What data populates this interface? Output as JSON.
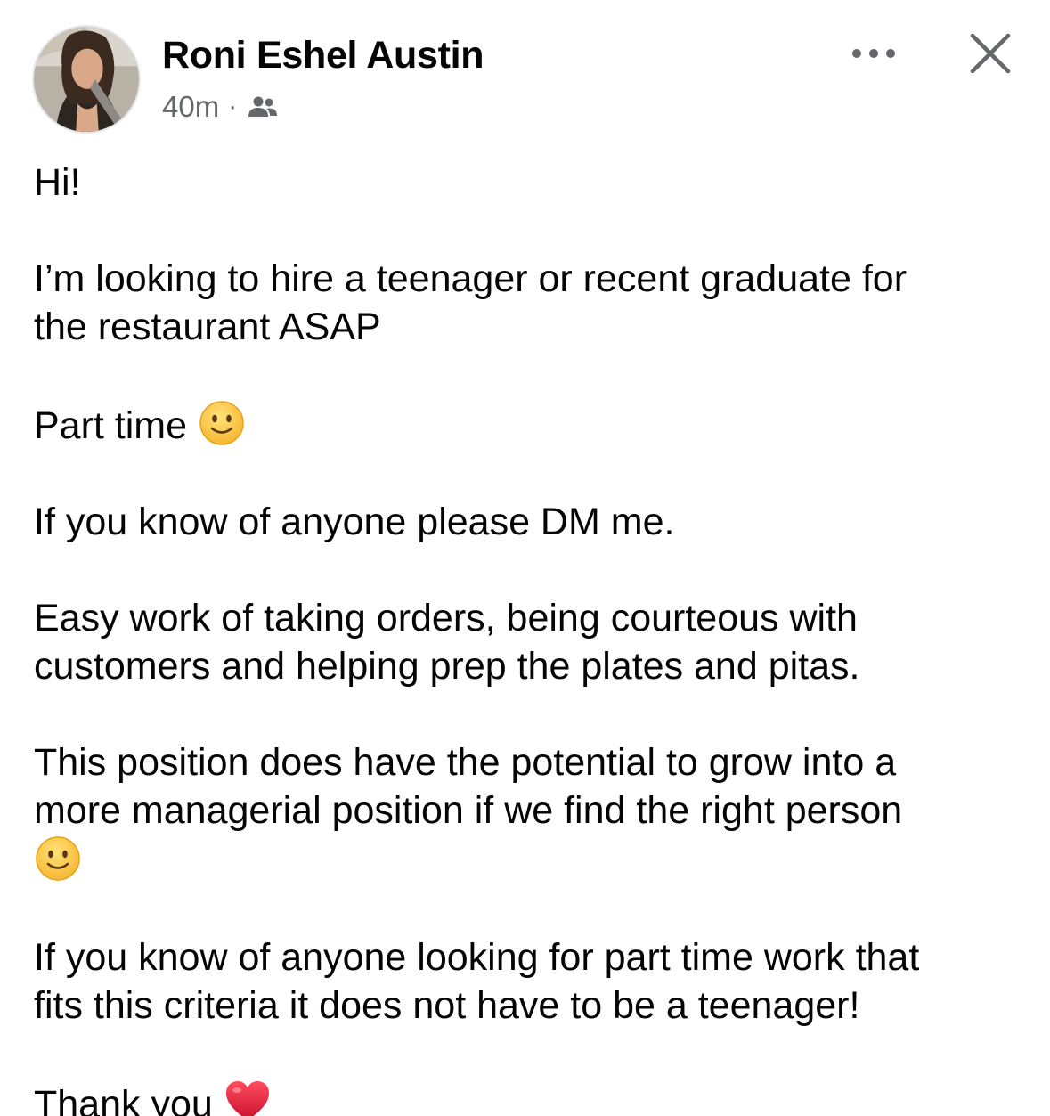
{
  "post": {
    "author": "Roni Eshel Austin",
    "timestamp": "40m",
    "separator": "·",
    "audience_icon": "friends-icon",
    "paragraphs": {
      "p1": "Hi!",
      "p2_line1": "I’m looking to hire a teenager or recent graduate for",
      "p2_line2": "the restaurant ASAP",
      "p3": "Part time",
      "p4": "If you know of anyone please DM me.",
      "p5_line1": "Easy work of taking orders, being courteous with",
      "p5_line2": "customers and helping prep the plates and pitas.",
      "p6_line1": "This position does have the potential to grow into a",
      "p6_line2": "more managerial position if we find the right person",
      "p7_line1": "If you know of anyone looking for part time work that",
      "p7_line2": "fits this criteria it does not have to be a teenager!",
      "p8": "Thank you"
    },
    "emojis": {
      "smile": "slightly-smiling-face-icon",
      "heart": "red-heart-icon"
    }
  },
  "colors": {
    "text": "#050505",
    "secondary": "#65676b",
    "emoji_yellow": "#ffcc4d",
    "heart_red": "#e0162b"
  }
}
